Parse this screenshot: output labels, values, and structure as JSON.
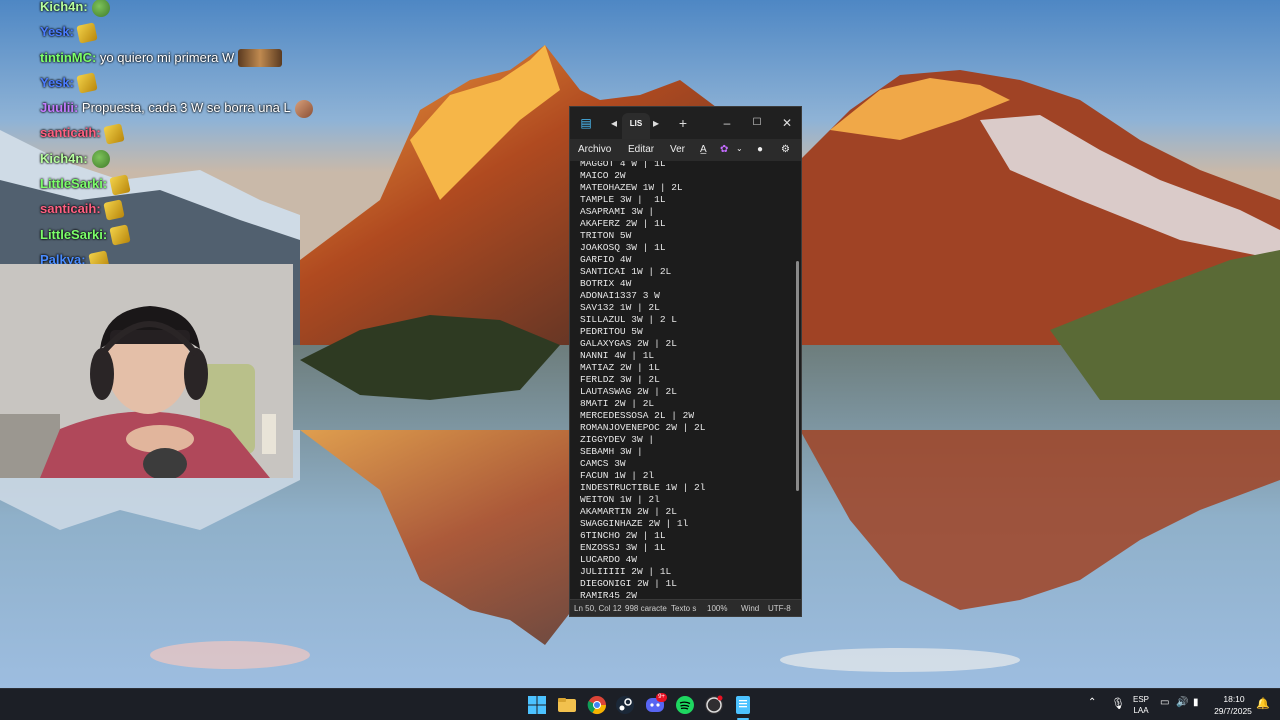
{
  "chat": {
    "messages": [
      {
        "user": "Kich4n",
        "text": "",
        "color": "#b7ff9f"
      },
      {
        "user": "Yesk",
        "text": "",
        "color": "#4a7cff"
      },
      {
        "user": "tintinMC",
        "text": "yo quiero mi primera W",
        "color": "#7cff6a"
      },
      {
        "user": "Yesk",
        "text": "",
        "color": "#4a7cff"
      },
      {
        "user": "Juulii",
        "text": "Propuesta, cada 3 W se borra una L",
        "color": "#c47cff"
      },
      {
        "user": "santicaih",
        "text": "",
        "color": "#ff5f80"
      },
      {
        "user": "Kich4n",
        "text": "",
        "color": "#b7ff9f"
      },
      {
        "user": "LittleSarki",
        "text": "",
        "color": "#7cff6a"
      },
      {
        "user": "santicaih",
        "text": "",
        "color": "#ff5f80"
      },
      {
        "user": "LittleSarki",
        "text": "",
        "color": "#7cff6a"
      },
      {
        "user": "Palkya",
        "text": "",
        "color": "#4a8cff"
      }
    ]
  },
  "notepad": {
    "tab_label": "LIS",
    "menu": {
      "file": "Archivo",
      "edit": "Editar",
      "view": "Ver"
    },
    "lines": [
      "MAGGOT 4 W | 1L",
      "MAICO 2W",
      "MATEOHAZEW 1W | 2L",
      "TAMPLE 3W |  1L",
      "ASAPRAMI 3W |",
      "AKAFERZ 2W | 1L",
      "TRITON 5W",
      "JOAKOSQ 3W | 1L",
      "GARFIO 4W",
      "SANTICAI 1W | 2L",
      "BOTRIX 4W",
      "ADONAI1337 3 W",
      "SAV132 1W | 2L",
      "SILLAZUL 3W | 2 L",
      "PEDRITOU 5W",
      "GALAXYGAS 2W | 2L",
      "NANNI 4W | 1L",
      "MATIAZ 2W | 1L",
      "FERLDZ 3W | 2L",
      "LAUTASWAG 2W | 2L",
      "8MATI 2W | 2L",
      "MERCEDESSOSA 2L | 2W",
      "ROMANJOVENEPOC 2W | 2L",
      "ZIGGYDEV 3W |",
      "SEBAMH 3W |",
      "CAMCS 3W",
      "FACUN 1W | 2l",
      "INDESTRUCTIBLE 1W | 2l",
      "WEITON 1W | 2l",
      "AKAMARTIN 2W | 2L",
      "SWAGGINHAZE 2W | 1l",
      "6TINCHO 2W | 1L",
      "ENZOSSJ 3W | 1L",
      "LUCARDO 4W",
      "JULIIIII 2W | 1L",
      "DIEGONIGI 2W | 1L",
      "RAMIR45 2W"
    ],
    "status": {
      "position": "Ln 50, Col 12",
      "chars": "998 caracte",
      "type": "Texto s",
      "zoom": "100%",
      "eol": "Wind",
      "encoding": "UTF-8"
    }
  },
  "taskbar": {
    "lang_top": "ESP",
    "lang_bottom": "LAA",
    "time": "18:10",
    "date": "29/7/2025",
    "discord_badge": "9+"
  },
  "colors": {
    "notepad_bg": "#1c1c1c",
    "taskbar_bg": "#1c1f26",
    "accent": "#4cc2ff"
  }
}
